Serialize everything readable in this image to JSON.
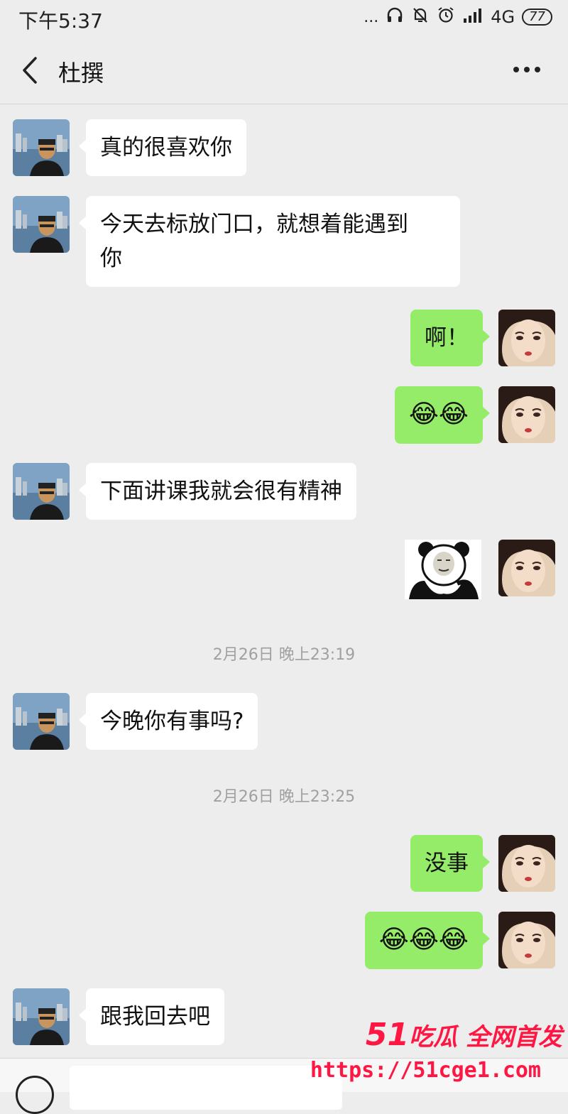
{
  "status_bar": {
    "time": "下午5:37",
    "dots": "...",
    "network": "4G",
    "battery": "77"
  },
  "header": {
    "title": "杜撰"
  },
  "messages": [
    {
      "side": "left",
      "text": "真的很喜欢你"
    },
    {
      "side": "left",
      "text_line1": "今天去标放门口，就想着能遇到",
      "text_line2": "你"
    },
    {
      "side": "right",
      "text": "啊！"
    },
    {
      "side": "right",
      "emoji": "😂😂"
    },
    {
      "side": "left",
      "text": "下面讲课我就会很有精神"
    },
    {
      "side": "right",
      "sticker": "panda-sticker"
    },
    {
      "side": "left",
      "text": "今晚你有事吗?"
    },
    {
      "side": "right",
      "text": "没事"
    },
    {
      "side": "right",
      "emoji": "😂😂😂"
    },
    {
      "side": "left",
      "text": "跟我回去吧"
    }
  ],
  "timestamps": [
    "2月26日 晚上23:19",
    "2月26日 晚上23:25"
  ],
  "watermark": {
    "brand_number": "51",
    "brand_text": "吃瓜 全网首发",
    "url": "https://51cge1.com"
  },
  "colors": {
    "background": "#ededed",
    "outgoing_bubble": "#95ec69",
    "incoming_bubble": "#ffffff",
    "watermark": "#ff1744"
  }
}
